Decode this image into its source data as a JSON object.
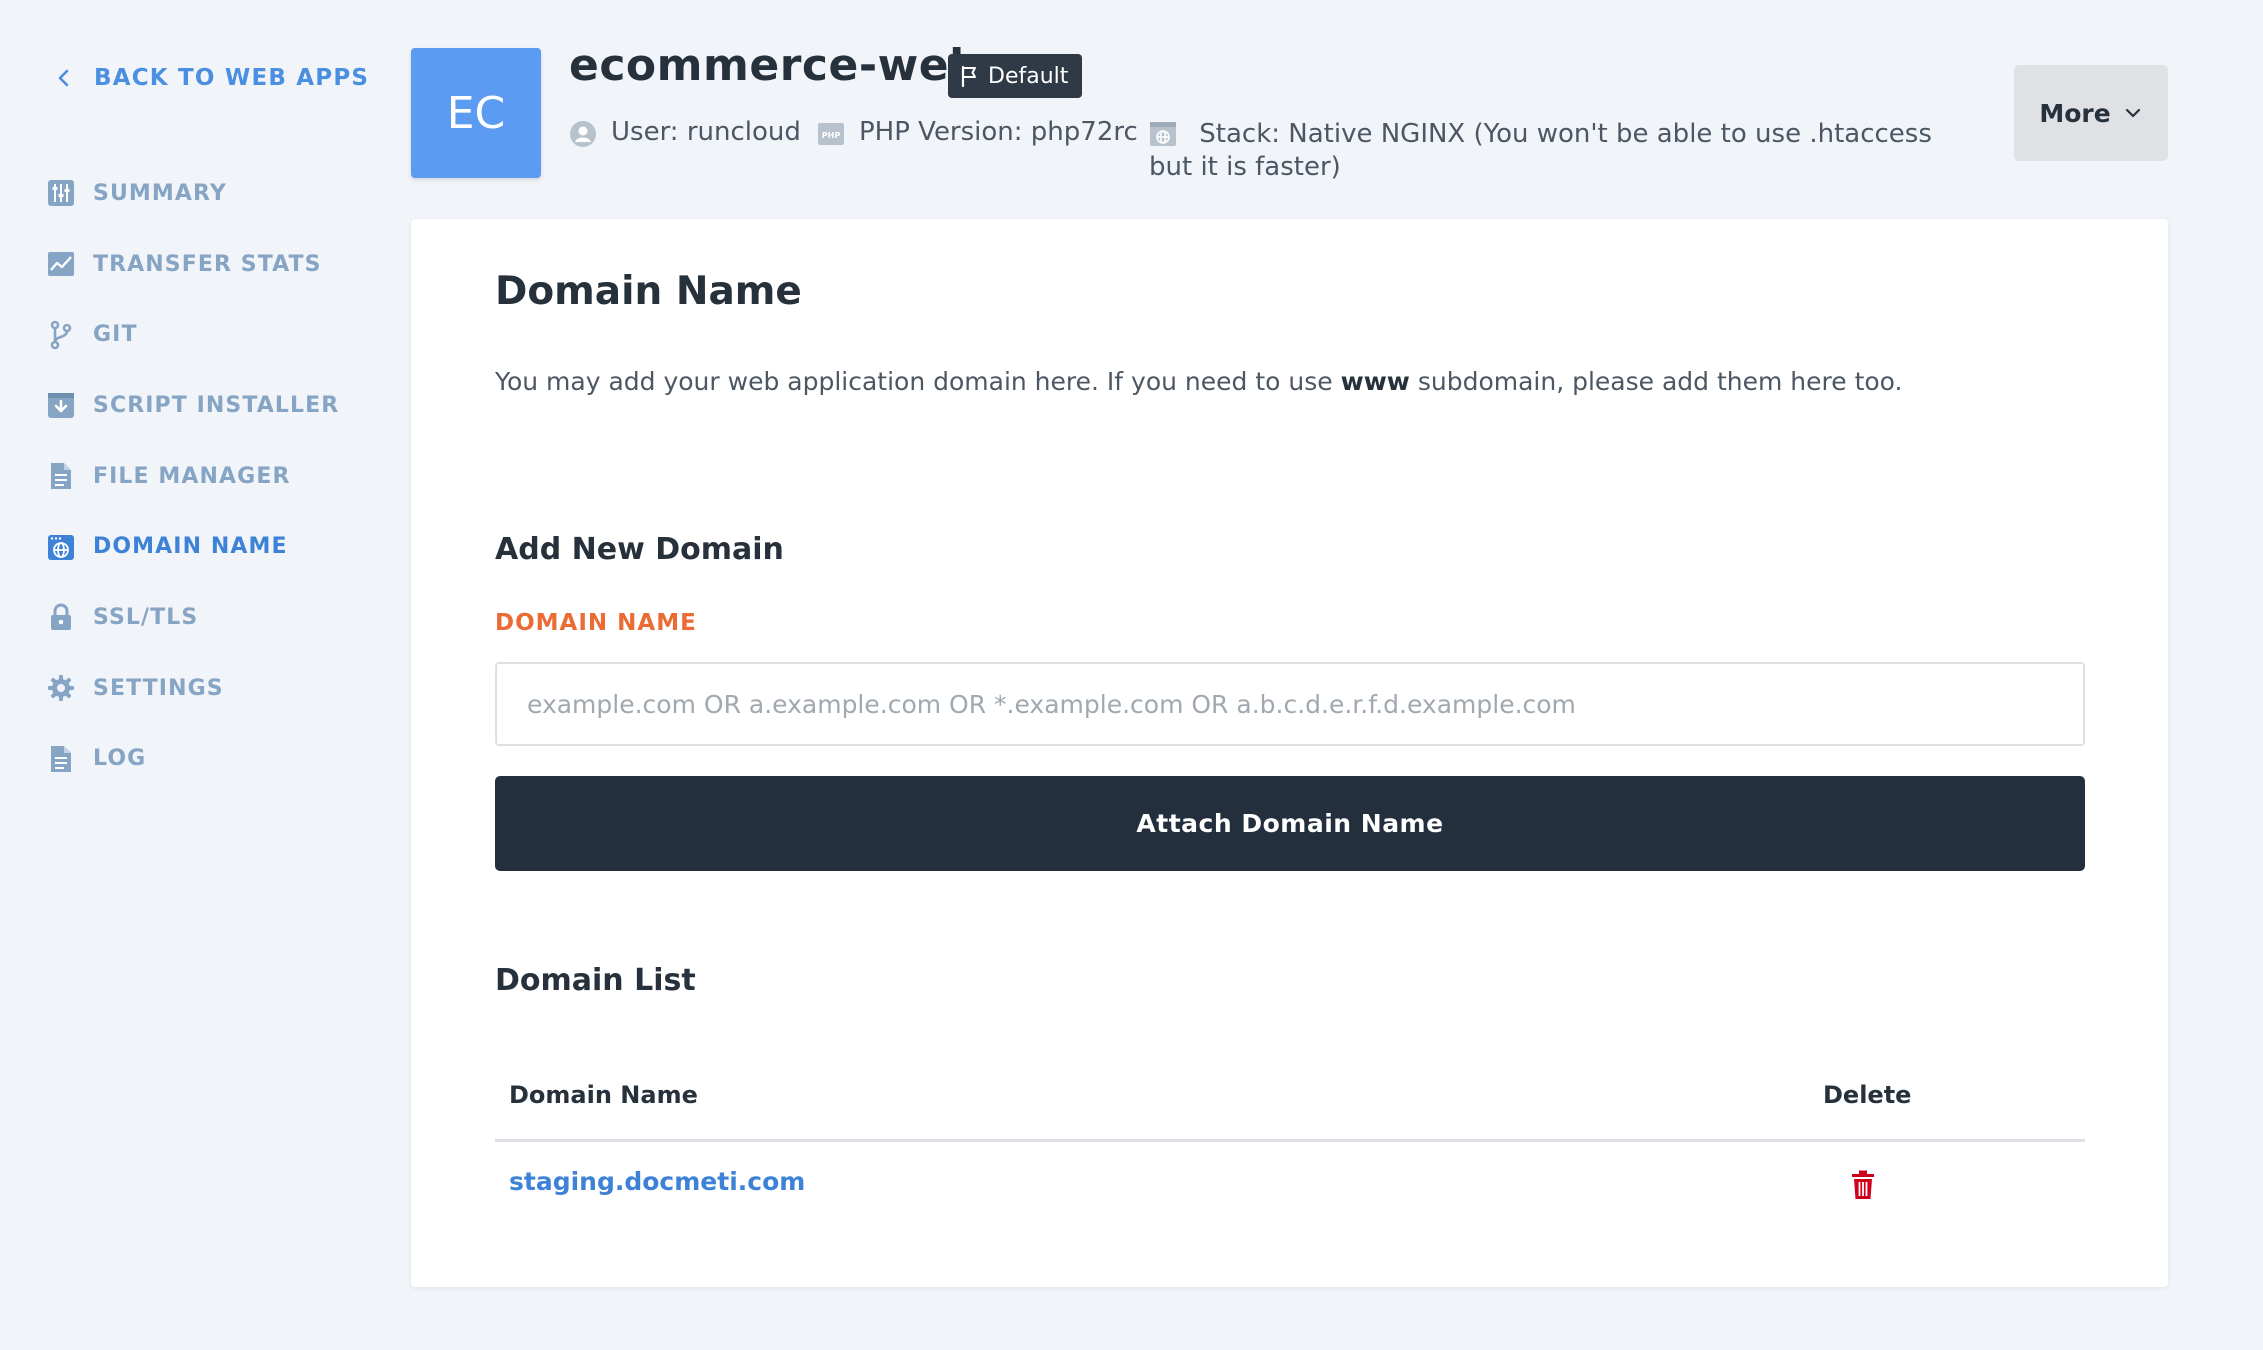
{
  "sidebar": {
    "back_label": "BACK TO WEB APPS",
    "items": [
      {
        "label": "SUMMARY",
        "icon": "summary-icon"
      },
      {
        "label": "TRANSFER STATS",
        "icon": "chart-icon"
      },
      {
        "label": "GIT",
        "icon": "git-branch-icon"
      },
      {
        "label": "SCRIPT INSTALLER",
        "icon": "download-box-icon"
      },
      {
        "label": "FILE MANAGER",
        "icon": "file-icon"
      },
      {
        "label": "DOMAIN NAME",
        "icon": "globe-window-icon",
        "active": true
      },
      {
        "label": "SSL/TLS",
        "icon": "lock-icon"
      },
      {
        "label": "SETTINGS",
        "icon": "gear-icon"
      },
      {
        "label": "LOG",
        "icon": "document-icon"
      }
    ]
  },
  "header": {
    "avatar_text": "EC",
    "app_name": "ecommerce-web",
    "badge_label": "Default",
    "user": "User: runcloud",
    "php": "PHP Version: php72rc",
    "stack": "Stack: Native NGINX (You won't be able to use .htaccess but it is faster)",
    "more_label": "More"
  },
  "main": {
    "title": "Domain Name",
    "desc_before": "You may add your web application domain here. If you need to use ",
    "desc_bold": "www",
    "desc_after": " subdomain, please add them here too.",
    "add_title": "Add New Domain",
    "field_label": "DOMAIN NAME",
    "input_placeholder": "example.com OR a.example.com OR *.example.com OR a.b.c.d.e.r.f.d.example.com",
    "input_value": "",
    "attach_label": "Attach Domain Name",
    "list_title": "Domain List",
    "table": {
      "columns": [
        "Domain Name",
        "Delete"
      ],
      "rows": [
        {
          "domain": "staging.docmeti.com"
        }
      ]
    }
  },
  "colors": {
    "accent": "#3d82d6",
    "sidebar_text": "#86a4c4",
    "avatar_bg": "#5b9bf1",
    "button_dark": "#232f3c",
    "label_orange": "#ea6b33",
    "delete_red": "#d0021b"
  }
}
